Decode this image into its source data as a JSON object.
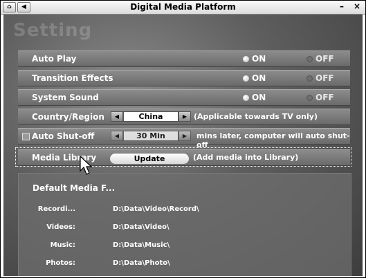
{
  "window": {
    "title": "Digital Media Platform",
    "home_icon": "home-icon",
    "back_icon": "back-arrow-icon",
    "minimize": "–",
    "close": "×"
  },
  "heading": "Setting",
  "rows": {
    "auto_play": {
      "label": "Auto Play",
      "on": "ON",
      "off": "OFF",
      "selected": "ON"
    },
    "transition": {
      "label": "Transition Effects",
      "on": "ON",
      "off": "OFF",
      "selected": "ON"
    },
    "system_sound": {
      "label": "System Sound",
      "on": "ON",
      "off": "OFF",
      "selected": "ON"
    },
    "country": {
      "label": "Country/Region",
      "value": "China",
      "note": "(Applicable towards TV only)"
    },
    "auto_shutoff": {
      "label": "Auto Shut-off",
      "value": "30 Min",
      "note": "mins later, computer will auto shut-off",
      "checked": false
    },
    "media_library": {
      "label": "Media Library",
      "button": "Update",
      "note": "(Add media into Library)"
    }
  },
  "default_media": {
    "title": "Default Media F...",
    "items": [
      {
        "label": "Recordi...",
        "path": "D:\\Data\\Video\\Record\\"
      },
      {
        "label": "Videos:",
        "path": "D:\\Data\\Video\\"
      },
      {
        "label": "Music:",
        "path": "D:\\Data\\Music\\"
      },
      {
        "label": "Photos:",
        "path": "D:\\Data\\Photo\\"
      }
    ]
  }
}
